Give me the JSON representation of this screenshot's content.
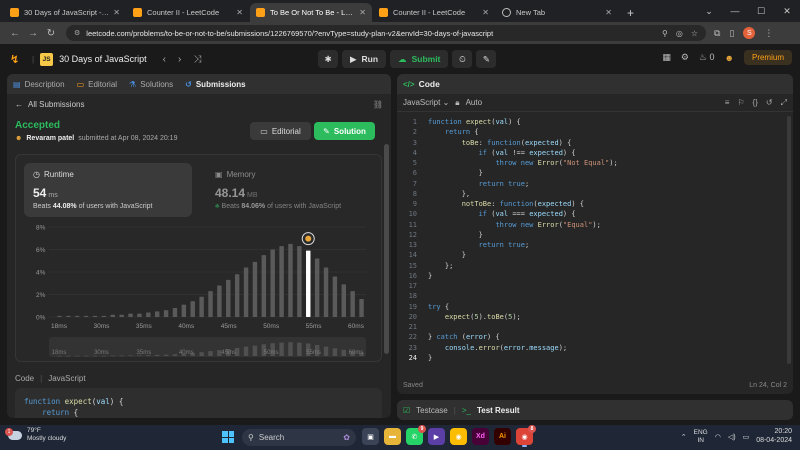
{
  "browser": {
    "tabs": [
      {
        "title": "30 Days of JavaScript - Study Pl",
        "icon": "leetcode-icon",
        "active": false
      },
      {
        "title": "Counter II - LeetCode",
        "icon": "leetcode-icon",
        "active": false
      },
      {
        "title": "To Be Or Not To Be - LeetCode",
        "icon": "leetcode-icon",
        "active": true
      },
      {
        "title": "Counter II - LeetCode",
        "icon": "leetcode-icon",
        "active": false
      },
      {
        "title": "New Tab",
        "icon": "chrome-icon",
        "active": false
      }
    ],
    "new_tab": "+",
    "url": "leetcode.com/problems/to-be-or-not-to-be/submissions/1226769570/?envType=study-plan-v2&envId=30-days-of-javascript",
    "profile_initial": "S"
  },
  "header": {
    "js_badge": "JS",
    "title": "30 Days of JavaScript",
    "run_label": "Run",
    "submit_label": "Submit",
    "fire_count": "0",
    "premium_label": "Premium"
  },
  "left": {
    "tabs": [
      {
        "label": "Description",
        "icon": "description-icon"
      },
      {
        "label": "Editorial",
        "icon": "book-icon"
      },
      {
        "label": "Solutions",
        "icon": "flask-icon"
      },
      {
        "label": "Submissions",
        "icon": "history-icon"
      }
    ],
    "back_label": "All Submissions",
    "status": "Accepted",
    "user": "Revaram patel",
    "submitted_text": "submitted at Apr 08, 2024 20:19",
    "editorial_btn": "Editorial",
    "solution_btn": "Solution",
    "runtime": {
      "label": "Runtime",
      "value": "54",
      "unit": "ms",
      "beats_prefix": "Beats",
      "beats_pct": "44.08%",
      "beats_suffix": "of users with JavaScript"
    },
    "memory": {
      "label": "Memory",
      "value": "48.14",
      "unit": "MB",
      "beats_prefix": "Beats",
      "beats_pct": "84.06%",
      "beats_suffix": "of users with JavaScript"
    },
    "code_header": {
      "label": "Code",
      "lang": "JavaScript"
    },
    "code_preview": [
      "function expect(val) {",
      "    return {"
    ]
  },
  "chart_data": {
    "type": "bar",
    "y_ticks": [
      "8%",
      "6%",
      "4%",
      "2%",
      "0%"
    ],
    "ylim": [
      0,
      8
    ],
    "x_ticks": [
      "18ms",
      "30ms",
      "35ms",
      "40ms",
      "45ms",
      "50ms",
      "55ms",
      "60ms"
    ],
    "values": [
      0.1,
      0.1,
      0.1,
      0.1,
      0.1,
      0.1,
      0.2,
      0.2,
      0.3,
      0.3,
      0.4,
      0.5,
      0.6,
      0.8,
      1.1,
      1.4,
      1.8,
      2.3,
      2.8,
      3.3,
      3.8,
      4.4,
      4.9,
      5.5,
      6.0,
      6.3,
      6.5,
      6.3,
      5.9,
      5.2,
      4.4,
      3.6,
      2.9,
      2.3,
      1.6
    ],
    "highlight_index": 28,
    "highlight_color": "#ffffff",
    "bar_color": "#5a5a5a"
  },
  "editor": {
    "title": "Code",
    "language": "JavaScript",
    "mode": "Auto",
    "lines": [
      "function expect(val) {",
      "    return {",
      "        toBe: function(expected) {",
      "            if (val !== expected) {",
      "                throw new Error(\"Not Equal\");",
      "            }",
      "            return true;",
      "        },",
      "        notToBe: function(expected) {",
      "            if (val === expected) {",
      "                throw new Error(\"Equal\");",
      "            }",
      "            return true;",
      "        }",
      "    };",
      "}",
      "",
      "",
      "try {",
      "    expect(5).toBe(5);",
      "",
      "} catch (error) {",
      "    console.error(error.message);",
      "}"
    ],
    "current_line": 24,
    "saved_label": "Saved",
    "cursor_pos": "Ln 24, Col 2"
  },
  "bottom_panel": {
    "testcase_label": "Testcase",
    "result_label": "Test Result"
  },
  "taskbar": {
    "weather_temp": "79°F",
    "weather_desc": "Mostly cloudy",
    "weather_badge": "1",
    "search_placeholder": "Search",
    "lang_line1": "ENG",
    "lang_line2": "IN",
    "time": "20:20",
    "date": "08-04-2024"
  }
}
